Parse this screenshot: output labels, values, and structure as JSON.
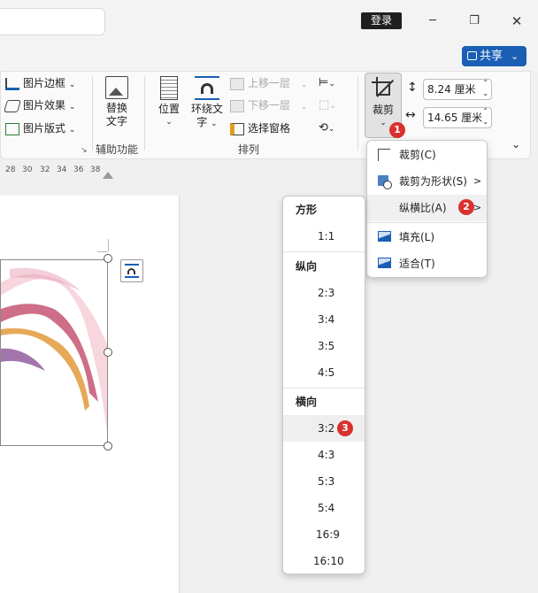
{
  "titlebar": {
    "login_label": "登录",
    "minimize": "─",
    "restore": "❐",
    "close": "✕"
  },
  "share": {
    "label": "共享",
    "chevron": "⌄"
  },
  "ribbon": {
    "picture_border": "图片边框",
    "picture_effect": "图片效果",
    "picture_layout": "图片版式",
    "alt_text_line1": "替换",
    "alt_text_line2": "文字",
    "accessibility_group": "辅助功能",
    "position": "位置",
    "wrap_text_line1": "环绕文",
    "wrap_text_line2": "字",
    "bring_forward": "上移一层",
    "send_backward": "下移一层",
    "selection_pane": "选择窗格",
    "arrange_group": "排列",
    "crop": "裁剪",
    "height_value": "8.24 厘米",
    "width_value": "14.65 厘米"
  },
  "ruler": {
    "ticks": [
      "28",
      "30",
      "32",
      "34",
      "36",
      "38"
    ]
  },
  "crop_menu": {
    "items": [
      {
        "label": "裁剪(C)",
        "icon": "crop-icon"
      },
      {
        "label": "裁剪为形状(S)",
        "icon": "crop-to-shape-icon",
        "submenu": ">"
      },
      {
        "label": "纵横比(A)",
        "submenu": ">"
      },
      {
        "label": "填充(L)",
        "icon": "fill-icon"
      },
      {
        "label": "适合(T)",
        "icon": "fit-icon"
      }
    ]
  },
  "aspect_menu": {
    "square_header": "方形",
    "square": [
      "1:1"
    ],
    "portrait_header": "纵向",
    "portrait": [
      "2:3",
      "3:4",
      "3:5",
      "4:5"
    ],
    "landscape_header": "横向",
    "landscape": [
      "3:2",
      "4:3",
      "5:3",
      "5:4",
      "16:9",
      "16:10"
    ]
  },
  "badges": [
    "1",
    "2",
    "3"
  ],
  "colors": {
    "accent": "#1a5fb4",
    "badge": "#d9312e"
  }
}
